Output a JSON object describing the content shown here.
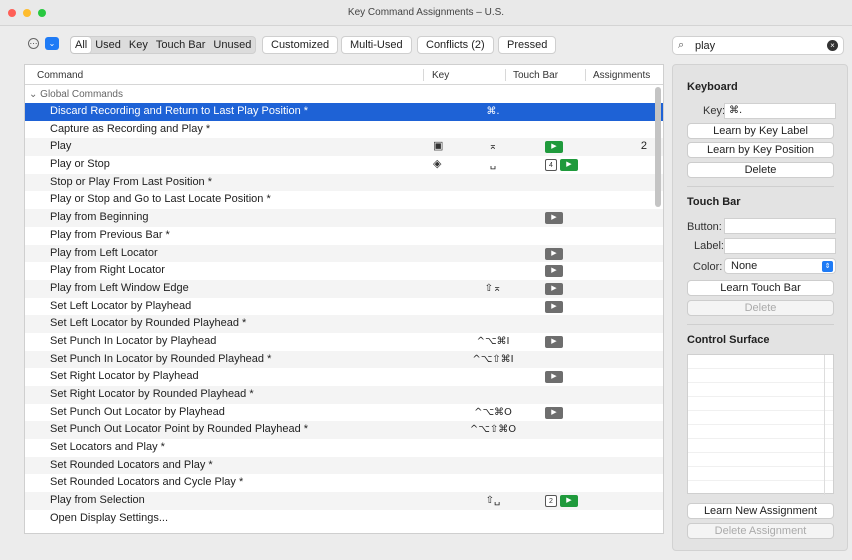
{
  "window": {
    "title": "Key Command Assignments – U.S."
  },
  "toolbar": {
    "filters": [
      "All",
      "Used",
      "Key",
      "Touch Bar",
      "Unused"
    ],
    "active_filter": "All",
    "buttons": {
      "customized": "Customized",
      "multi_used": "Multi-Used",
      "conflicts": "Conflicts (2)",
      "pressed": "Pressed"
    },
    "search_value": "play"
  },
  "table": {
    "headers": {
      "command": "Command",
      "key": "Key",
      "touch_bar": "Touch Bar",
      "assignments": "Assignments"
    },
    "group": "Global Commands",
    "rows": [
      {
        "command": "Discard Recording and Return to Last Play Position *",
        "key": "⌘.",
        "selected": true
      },
      {
        "command": "Capture as Recording and Play *",
        "key": ""
      },
      {
        "command": "Play",
        "key": "⌅",
        "key_icon": "keypad-icon",
        "tb": [
          "play-green"
        ],
        "assignments": "2"
      },
      {
        "command": "Play or Stop",
        "key": "␣",
        "key_icon": "layers-icon",
        "tb": [
          "4",
          "play-green"
        ]
      },
      {
        "command": "Stop or Play From Last Position *",
        "key": ""
      },
      {
        "command": "Play or Stop and Go to Last Locate Position *",
        "key": ""
      },
      {
        "command": "Play from Beginning",
        "key": "",
        "tb": [
          "gray"
        ]
      },
      {
        "command": "Play from Previous Bar *",
        "key": ""
      },
      {
        "command": "Play from Left Locator",
        "key": "",
        "tb": [
          "gray"
        ]
      },
      {
        "command": "Play from Right Locator",
        "key": "",
        "tb": [
          "gray"
        ]
      },
      {
        "command": "Play from Left Window Edge",
        "key": "⇧⌅",
        "tb": [
          "gray"
        ]
      },
      {
        "command": "Set Left Locator by Playhead",
        "key": "",
        "tb": [
          "gray"
        ]
      },
      {
        "command": "Set Left Locator by Rounded Playhead *",
        "key": ""
      },
      {
        "command": "Set Punch In Locator by Playhead",
        "key": "^⌥⌘I",
        "tb": [
          "gray"
        ]
      },
      {
        "command": "Set Punch In Locator by Rounded Playhead *",
        "key": "^⌥⇧⌘I"
      },
      {
        "command": "Set Right Locator by Playhead",
        "key": "",
        "tb": [
          "gray"
        ]
      },
      {
        "command": "Set Right Locator by Rounded Playhead *",
        "key": ""
      },
      {
        "command": "Set Punch Out Locator by Playhead",
        "key": "^⌥⌘O",
        "tb": [
          "gray"
        ]
      },
      {
        "command": "Set Punch Out Locator Point by Rounded Playhead *",
        "key": "^⌥⇧⌘O"
      },
      {
        "command": "Set Locators and Play *",
        "key": ""
      },
      {
        "command": "Set Rounded Locators and Play *",
        "key": ""
      },
      {
        "command": "Set Rounded Locators and Cycle Play *",
        "key": ""
      },
      {
        "command": "Play from Selection",
        "key": "⇧␣",
        "tb": [
          "2",
          "play-green"
        ]
      },
      {
        "command": "Open Display Settings...",
        "key": ""
      }
    ]
  },
  "panel": {
    "keyboard": {
      "heading": "Keyboard",
      "key_label": "Key:",
      "key_value": "⌘.",
      "learn_label": "Learn by Key Label",
      "learn_position": "Learn by Key Position",
      "delete": "Delete"
    },
    "touchbar": {
      "heading": "Touch Bar",
      "button_label": "Button:",
      "label_label": "Label:",
      "color_label": "Color:",
      "color_value": "None",
      "learn": "Learn Touch Bar",
      "delete": "Delete"
    },
    "control_surface": {
      "heading": "Control Surface",
      "learn_new": "Learn New Assignment",
      "delete_assignment": "Delete Assignment"
    }
  },
  "colors": {
    "selection": "#1e62d6",
    "accent": "#1f7bf5",
    "touchbar_green": "#1f9a3c"
  }
}
